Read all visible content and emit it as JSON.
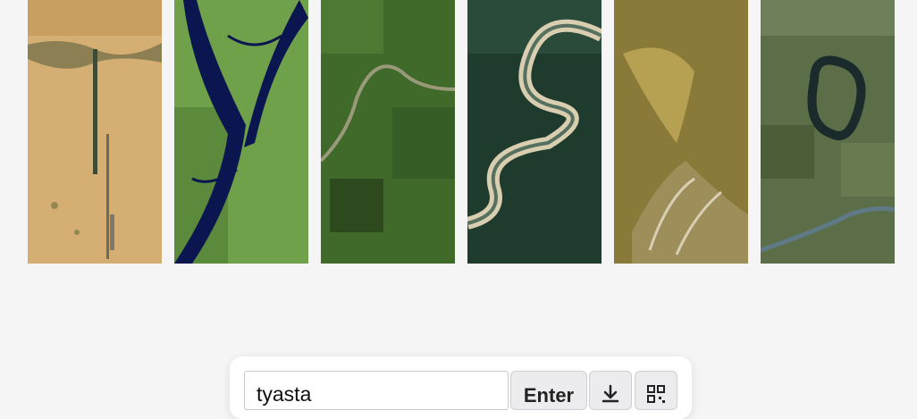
{
  "gallery": {
    "tiles": [
      {
        "icon": "desert-road-satellite-image"
      },
      {
        "icon": "river-delta-satellite-image"
      },
      {
        "icon": "farmland-river-satellite-image"
      },
      {
        "icon": "meandering-river-satellite-image"
      },
      {
        "icon": "sediment-delta-satellite-image"
      },
      {
        "icon": "oxbow-lake-satellite-image"
      }
    ]
  },
  "search": {
    "value": "tyasta",
    "enter_label": "Enter",
    "download_icon": "download-icon",
    "qr_icon": "qr-code-icon"
  },
  "colors": {
    "page_bg": "#f5f5f6",
    "desert": "#d4ae72",
    "delta_water": "#0b1550",
    "delta_land": "#6fa04a",
    "forest": "#1f3b2e",
    "sediment": "#8a7a3a"
  }
}
